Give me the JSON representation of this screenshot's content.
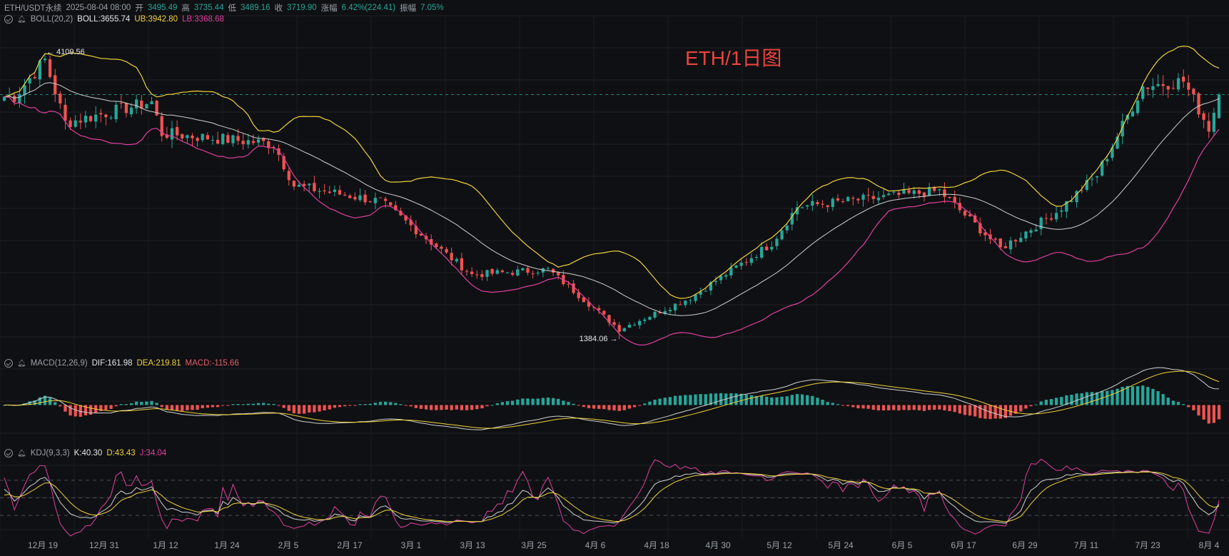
{
  "header": {
    "symbol": "ETH/USDT永续",
    "datetime": "2025-08-04 08:00",
    "open_label": "开",
    "open": "3495.49",
    "high_label": "高",
    "high": "3735.44",
    "low_label": "低",
    "low": "3489.16",
    "close_label": "收",
    "close": "3719.90",
    "change_label": "涨幅",
    "change": "6.42%(224.41)",
    "amp_label": "振幅",
    "amp": "7.05%"
  },
  "boll": {
    "name": "BOLL(20,2)",
    "mid": "BOLL:3655.74",
    "ub": "UB:3942.80",
    "lb": "LB:3368.68"
  },
  "macd": {
    "name": "MACD(12,26,9)",
    "dif": "DIF:161.98",
    "dea": "DEA:219.81",
    "macd": "MACD:-115.66"
  },
  "kdj": {
    "name": "KDJ(9,3,3)",
    "k": "K:40.30",
    "d": "D:43.43",
    "j": "J:34.04"
  },
  "watermark": "ETH/1日图",
  "annotations": {
    "high": "← 4109.56",
    "low": "1384.06 →"
  },
  "colors": {
    "up": "#26a69a",
    "down": "#ef5350",
    "boll_mid": "#d0d0d0",
    "boll_ub": "#f0d23a",
    "boll_lb": "#e040a0",
    "dif": "#d0d0d0",
    "dea": "#f0d23a",
    "k": "#d0d0d0",
    "d": "#f0d23a",
    "j": "#e040a0"
  },
  "chart_data": {
    "type": "candlestick",
    "x_ticks": [
      "12月 19",
      "12月 31",
      "1月 12",
      "1月 24",
      "2月 5",
      "2月 17",
      "3月 1",
      "3月 13",
      "3月 25",
      "4月 6",
      "4月 18",
      "4月 30",
      "5月 12",
      "5月 24",
      "6月 5",
      "6月 17",
      "6月 29",
      "7月 11",
      "7月 23",
      "8月 4"
    ],
    "price_keypoints": [
      {
        "date": "2024-12-10",
        "close": 3700
      },
      {
        "date": "2024-12-16",
        "close": 4050
      },
      {
        "date": "2024-12-20",
        "close": 3450
      },
      {
        "date": "2025-01-06",
        "close": 3650
      },
      {
        "date": "2025-01-08",
        "close": 3350
      },
      {
        "date": "2025-01-30",
        "close": 3250
      },
      {
        "date": "2025-02-03",
        "close": 2850
      },
      {
        "date": "2025-02-20",
        "close": 2700
      },
      {
        "date": "2025-03-10",
        "close": 2000
      },
      {
        "date": "2025-03-25",
        "close": 2050
      },
      {
        "date": "2025-04-08",
        "close": 1480
      },
      {
        "date": "2025-04-22",
        "close": 1780
      },
      {
        "date": "2025-05-08",
        "close": 2300
      },
      {
        "date": "2025-05-13",
        "close": 2650
      },
      {
        "date": "2025-06-10",
        "close": 2800
      },
      {
        "date": "2025-06-22",
        "close": 2250
      },
      {
        "date": "2025-07-03",
        "close": 2600
      },
      {
        "date": "2025-07-11",
        "close": 2950
      },
      {
        "date": "2025-07-20",
        "close": 3800
      },
      {
        "date": "2025-07-28",
        "close": 3850
      },
      {
        "date": "2025-08-02",
        "close": 3400
      },
      {
        "date": "2025-08-04",
        "close": 3719.9
      }
    ],
    "high_marker": 4109.56,
    "low_marker": 1384.06,
    "latest": {
      "open": 3495.49,
      "high": 3735.44,
      "low": 3489.16,
      "close": 3719.9
    },
    "indicators": [
      "BOLL(20,2)",
      "MACD(12,26,9)",
      "KDJ(9,3,3)"
    ],
    "ylim": [
      1250,
      4350
    ]
  }
}
